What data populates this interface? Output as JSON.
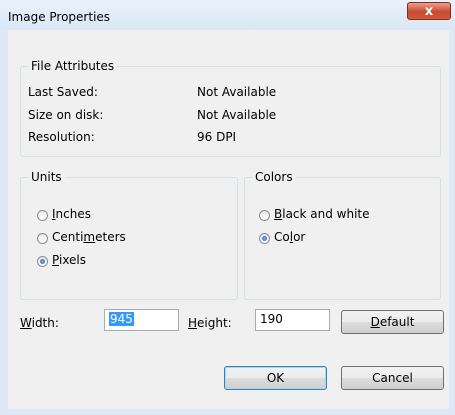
{
  "window": {
    "title": "Image Properties",
    "close_label": "x"
  },
  "file_attributes": {
    "legend": "File Attributes",
    "rows": [
      {
        "label": "Last Saved:",
        "value": "Not Available"
      },
      {
        "label": "Size on disk:",
        "value": "Not Available"
      },
      {
        "label": "Resolution:",
        "value": "96 DPI"
      }
    ]
  },
  "units": {
    "legend": "Units",
    "options": [
      {
        "prefix": "",
        "mnemonic": "I",
        "suffix": "nches",
        "checked": false
      },
      {
        "prefix": "Centi",
        "mnemonic": "m",
        "suffix": "eters",
        "checked": false
      },
      {
        "prefix": "",
        "mnemonic": "P",
        "suffix": "ixels",
        "checked": true
      }
    ]
  },
  "colors": {
    "legend": "Colors",
    "options": [
      {
        "prefix": "",
        "mnemonic": "B",
        "suffix": "lack and white",
        "checked": false
      },
      {
        "prefix": "Co",
        "mnemonic": "l",
        "suffix": "or",
        "checked": true
      }
    ]
  },
  "size": {
    "width_mnemonic": "W",
    "width_rest": "idth:",
    "width_value": "945",
    "height_mnemonic": "H",
    "height_rest": "eight:",
    "height_value": "190"
  },
  "buttons": {
    "default_mnemonic": "D",
    "default_rest": "efault",
    "ok": "OK",
    "cancel": "Cancel"
  }
}
